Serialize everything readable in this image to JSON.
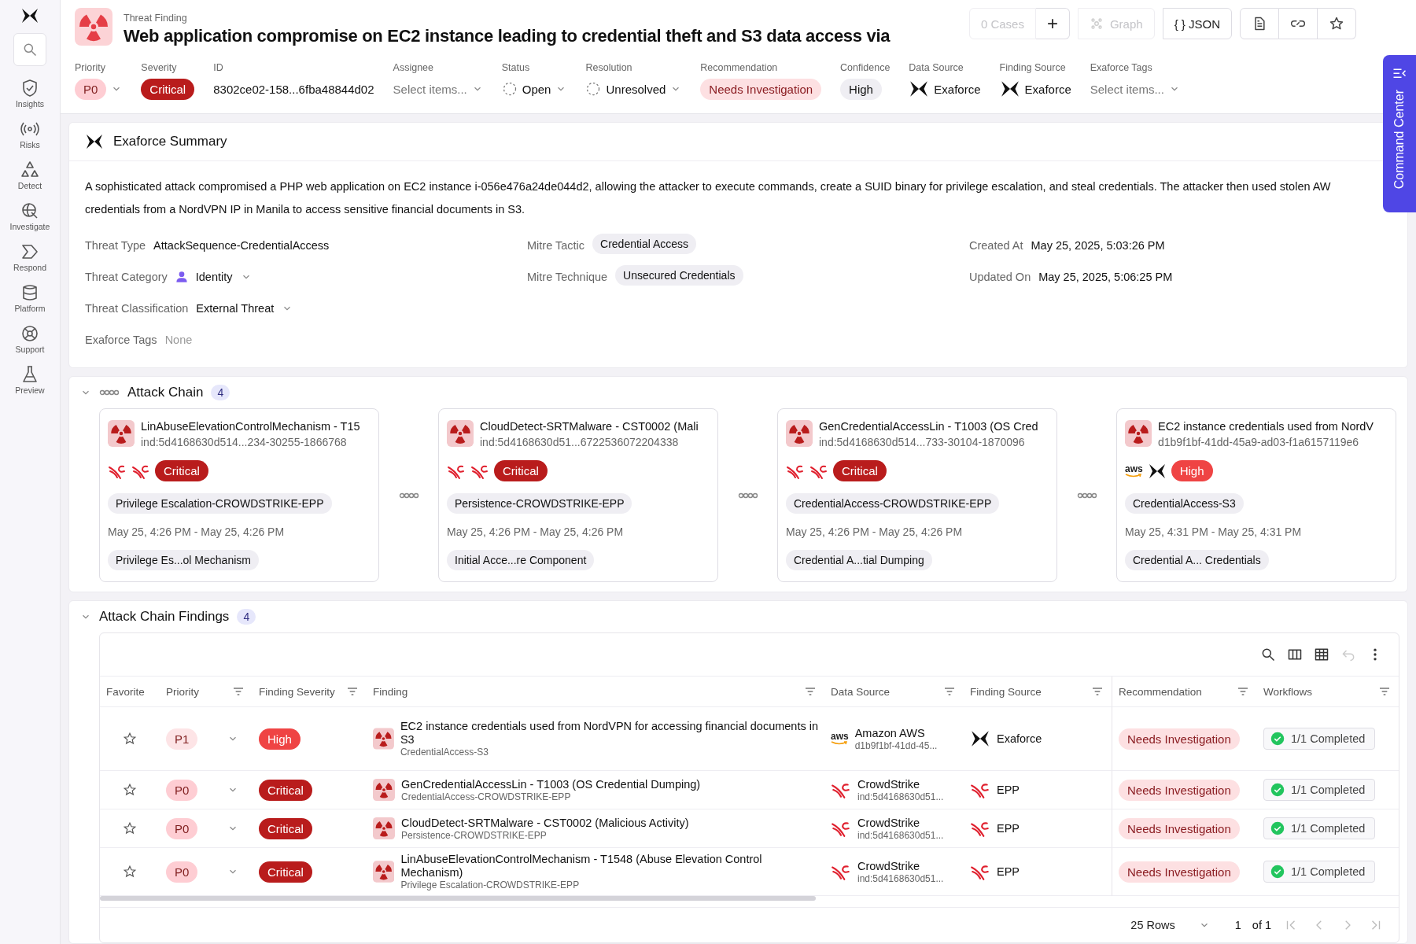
{
  "sidebar": {
    "search_selected": false,
    "items": [
      {
        "label": "Insights",
        "selected": false
      },
      {
        "label": "Risks",
        "selected": false
      },
      {
        "label": "Detect",
        "selected": false
      },
      {
        "label": "Investigate",
        "selected": false
      },
      {
        "label": "Respond",
        "selected": false
      },
      {
        "label": "Platform",
        "selected": false
      },
      {
        "label": "Support",
        "selected": false
      },
      {
        "label": "Preview",
        "selected": false
      }
    ]
  },
  "header": {
    "eyebrow": "Threat Finding",
    "title": "Web application compromise on EC2 instance leading to credential theft and S3 data access via",
    "actions": [
      {
        "kind": "cases",
        "label": "0 Cases",
        "disabled": true
      },
      {
        "kind": "add",
        "label": "+",
        "disabled": false
      },
      {
        "kind": "graph",
        "label": "Graph",
        "disabled": true
      },
      {
        "kind": "json",
        "label": "{ } JSON",
        "disabled": false
      },
      {
        "kind": "document",
        "disabled": false
      },
      {
        "kind": "link",
        "disabled": false
      },
      {
        "kind": "star",
        "disabled": false
      }
    ],
    "fields": [
      {
        "label": "Priority",
        "kind": "priority",
        "badge": {
          "label": "P0",
          "kind": "p0"
        }
      },
      {
        "label": "Severity",
        "kind": "severity",
        "badge": {
          "label": "Critical",
          "kind": "critical"
        }
      },
      {
        "label": "ID",
        "kind": "text",
        "value": "8302ce02-158...6fba48844d02"
      },
      {
        "label": "Assignee",
        "kind": "select",
        "placeholder": "Select items..."
      },
      {
        "label": "Status",
        "kind": "status",
        "value": "Open"
      },
      {
        "label": "Resolution",
        "kind": "status",
        "value": "Unresolved"
      },
      {
        "label": "Recommendation",
        "kind": "recommendation",
        "value": "Needs Investigation"
      },
      {
        "label": "Confidence",
        "kind": "chip",
        "value": "High"
      },
      {
        "label": "Data Source",
        "kind": "source",
        "source": {
          "name": "Exaforce",
          "kind": "exaforce"
        }
      },
      {
        "label": "Finding Source",
        "kind": "source",
        "source": {
          "name": "Exaforce",
          "kind": "exaforce"
        }
      },
      {
        "label": "Exaforce Tags",
        "kind": "select",
        "placeholder": "Select items..."
      }
    ]
  },
  "command_center": {
    "label": "Command Center"
  },
  "summary": {
    "title": "Exaforce Summary",
    "text": "A sophisticated attack compromised a PHP web application on EC2 instance i-056e476a24de044d2, allowing the attacker to execute commands, create a SUID binary for privilege escalation, and steal credentials. The attacker then used stolen AW\ncredentials from a NordVPN IP in Manila to access sensitive financial documents in S3.",
    "columns": [
      [
        {
          "label": "Threat Type",
          "kind": "text",
          "value": "AttackSequence-CredentialAccess"
        },
        {
          "label": "Threat Category",
          "kind": "identity",
          "value": "Identity"
        },
        {
          "label": "Threat Classification",
          "kind": "dropdown",
          "value": "External Threat"
        },
        {
          "label": "Exaforce Tags",
          "kind": "muted",
          "value": "None"
        }
      ],
      [
        {
          "label": "Mitre Tactic",
          "kind": "chip",
          "value": "Credential Access"
        },
        {
          "label": "Mitre Technique",
          "kind": "chip",
          "value": "Unsecured Credentials"
        }
      ],
      [
        {
          "label": "Created At",
          "kind": "text",
          "value": "May 25, 2025, 5:03:26 PM"
        },
        {
          "label": "Updated On",
          "kind": "text",
          "value": "May 25, 2025, 5:06:25 PM"
        }
      ]
    ]
  },
  "attack_chain": {
    "title": "Attack Chain",
    "count": "4",
    "expanded": true,
    "cards": [
      {
        "title": "LinAbuseElevationControlMechanism - T15",
        "id": "ind:5d4168630d514...234-30255-1866768",
        "sources": [
          {
            "kind": "crowdstrike"
          },
          {
            "kind": "crowdstrike"
          }
        ],
        "severity": {
          "label": "Critical",
          "kind": "critical"
        },
        "category": "Privilege Escalation-CROWDSTRIKE-EPP",
        "dates": "May 25, 4:26 PM - May 25, 4:26 PM",
        "technique": "Privilege Es...ol Mechanism"
      },
      {
        "title": "CloudDetect-SRTMalware - CST0002 (Mali",
        "id": "ind:5d4168630d51...6722536072204338",
        "sources": [
          {
            "kind": "crowdstrike"
          },
          {
            "kind": "crowdstrike"
          }
        ],
        "severity": {
          "label": "Critical",
          "kind": "critical"
        },
        "category": "Persistence-CROWDSTRIKE-EPP",
        "dates": "May 25, 4:26 PM - May 25, 4:26 PM",
        "technique": "Initial Acce...re Component"
      },
      {
        "title": "GenCredentialAccessLin - T1003 (OS Cred",
        "id": "ind:5d4168630d514...733-30104-1870096",
        "sources": [
          {
            "kind": "crowdstrike"
          },
          {
            "kind": "crowdstrike"
          }
        ],
        "severity": {
          "label": "Critical",
          "kind": "critical"
        },
        "category": "CredentialAccess-CROWDSTRIKE-EPP",
        "dates": "May 25, 4:26 PM - May 25, 4:26 PM",
        "technique": "Credential A...tial Dumping"
      },
      {
        "title": "EC2 instance credentials used from NordV",
        "id": "d1b9f1bf-41dd-45a9-ad03-f1a6157119e6",
        "sources": [
          {
            "kind": "aws",
            "logo_text": "aws"
          },
          {
            "kind": "exaforce"
          }
        ],
        "severity": {
          "label": "High",
          "kind": "high"
        },
        "category": "CredentialAccess-S3",
        "dates": "May 25, 4:31 PM - May 25, 4:31 PM",
        "technique": "Credential A... Credentials"
      }
    ]
  },
  "findings": {
    "title": "Attack Chain Findings",
    "count": "4",
    "expanded": true,
    "toolbar": [
      {
        "kind": "search",
        "disabled": false
      },
      {
        "kind": "columns",
        "disabled": false
      },
      {
        "kind": "table",
        "disabled": false
      },
      {
        "kind": "undo",
        "disabled": true
      },
      {
        "kind": "more",
        "disabled": false
      }
    ],
    "columns": [
      {
        "label": "Favorite",
        "filter": false
      },
      {
        "label": "Priority",
        "filter": true
      },
      {
        "label": "Finding Severity",
        "filter": true
      },
      {
        "label": "Finding",
        "filter": true
      },
      {
        "label": "Data Source",
        "filter": true
      },
      {
        "label": "Finding Source",
        "filter": true
      },
      {
        "label": "Recommendation",
        "filter": true
      },
      {
        "label": "Workflows",
        "filter": true
      }
    ],
    "rows": [
      {
        "favorite": false,
        "priority": {
          "label": "P1",
          "kind": "p1"
        },
        "severity": {
          "label": "High",
          "kind": "high"
        },
        "title": "EC2 instance credentials used from NordVPN for accessing financial documents in S3",
        "subtitle": "CredentialAccess-S3",
        "data_source": {
          "kind": "aws",
          "logo_text": "aws",
          "name": "Amazon AWS",
          "id": "d1b9f1bf-41dd-45..."
        },
        "finding_source": {
          "kind": "exaforce",
          "name": "Exaforce"
        },
        "recommendation": "Needs Investigation",
        "workflow": "1/1 Completed"
      },
      {
        "favorite": false,
        "priority": {
          "label": "P0",
          "kind": "p0"
        },
        "severity": {
          "label": "Critical",
          "kind": "critical"
        },
        "title": "GenCredentialAccessLin - T1003 (OS Credential Dumping)",
        "subtitle": "CredentialAccess-CROWDSTRIKE-EPP",
        "data_source": {
          "kind": "crowdstrike",
          "name": "CrowdStrike",
          "id": "ind:5d4168630d51..."
        },
        "finding_source": {
          "kind": "crowdstrike",
          "name": "EPP"
        },
        "recommendation": "Needs Investigation",
        "workflow": "1/1 Completed"
      },
      {
        "favorite": false,
        "priority": {
          "label": "P0",
          "kind": "p0"
        },
        "severity": {
          "label": "Critical",
          "kind": "critical"
        },
        "title": "CloudDetect-SRTMalware - CST0002 (Malicious Activity)",
        "subtitle": "Persistence-CROWDSTRIKE-EPP",
        "data_source": {
          "kind": "crowdstrike",
          "name": "CrowdStrike",
          "id": "ind:5d4168630d51..."
        },
        "finding_source": {
          "kind": "crowdstrike",
          "name": "EPP"
        },
        "recommendation": "Needs Investigation",
        "workflow": "1/1 Completed"
      },
      {
        "favorite": false,
        "priority": {
          "label": "P0",
          "kind": "p0"
        },
        "severity": {
          "label": "Critical",
          "kind": "critical"
        },
        "title": "LinAbuseElevationControlMechanism - T1548 (Abuse Elevation Control Mechanism)",
        "subtitle": "Privilege Escalation-CROWDSTRIKE-EPP",
        "data_source": {
          "kind": "crowdstrike",
          "name": "CrowdStrike",
          "id": "ind:5d4168630d51..."
        },
        "finding_source": {
          "kind": "crowdstrike",
          "name": "EPP"
        },
        "recommendation": "Needs Investigation",
        "workflow": "1/1 Completed"
      }
    ],
    "footer": {
      "rows": "25 Rows",
      "page": "1",
      "of": "of 1",
      "nav": [
        {
          "kind": "first",
          "disabled": true
        },
        {
          "kind": "prev",
          "disabled": true
        },
        {
          "kind": "next",
          "disabled": true
        },
        {
          "kind": "last",
          "disabled": true
        }
      ]
    }
  }
}
